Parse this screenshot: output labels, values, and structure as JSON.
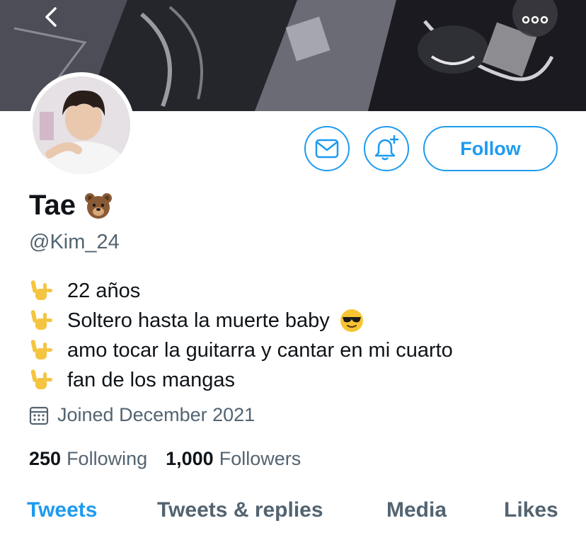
{
  "header": {
    "back_icon": "chevron-left-icon",
    "more_icon": "more-horizontal-icon",
    "banner_image": "manga-panel-banner"
  },
  "actions": {
    "message_icon": "envelope-icon",
    "notify_icon": "bell-plus-icon",
    "follow_label": "Follow",
    "accent_color": "#1d9bf0"
  },
  "profile": {
    "name": "Tae",
    "name_emoji": "bear-face-emoji",
    "handle": "@Kim_24",
    "bio": [
      {
        "icon": "love-you-gesture-emoji",
        "text": "22 años"
      },
      {
        "icon": "love-you-gesture-emoji",
        "text": "Soltero hasta la muerte baby",
        "trailing_icon": "sunglasses-face-emoji"
      },
      {
        "icon": "love-you-gesture-emoji",
        "text": "amo tocar la guitarra y cantar en mi cuarto"
      },
      {
        "icon": "love-you-gesture-emoji",
        "text": "fan de los mangas"
      }
    ],
    "joined_icon": "calendar-icon",
    "joined": "Joined December 2021"
  },
  "stats": {
    "following_count": "250",
    "following_label": "Following",
    "followers_count": "1,000",
    "followers_label": "Followers"
  },
  "tabs": [
    {
      "label": "Tweets",
      "active": true
    },
    {
      "label": "Tweets & replies",
      "active": false
    },
    {
      "label": "Media",
      "active": false
    },
    {
      "label": "Likes",
      "active": false
    }
  ]
}
